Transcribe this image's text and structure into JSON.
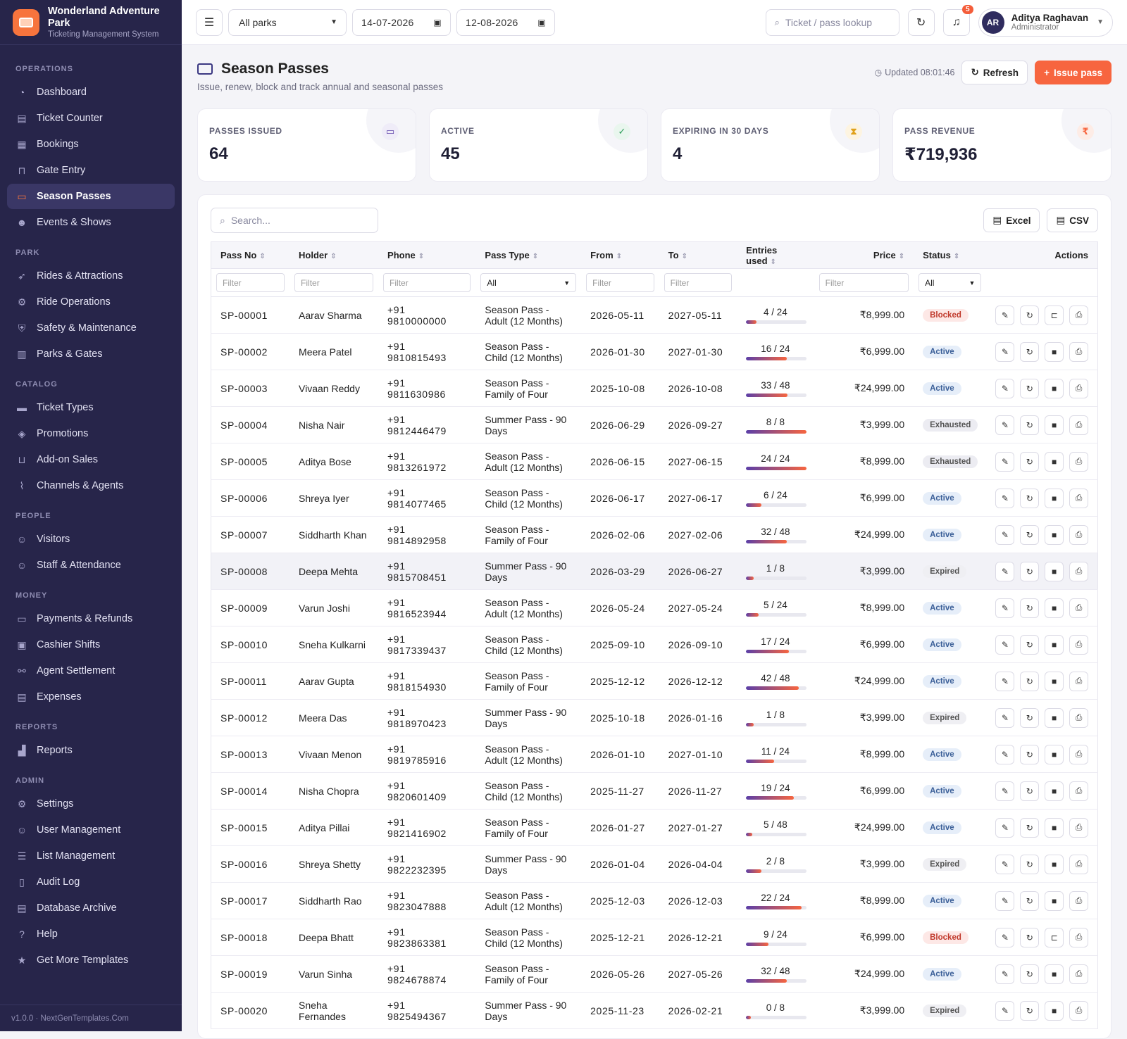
{
  "brand": {
    "name": "Wonderland Adventure Park",
    "subtitle": "Ticketing Management System"
  },
  "nav": [
    {
      "section": "OPERATIONS",
      "items": [
        {
          "label": "Dashboard",
          "icon": "gauge-icon",
          "glyph": "◔"
        },
        {
          "label": "Ticket Counter",
          "icon": "counter-icon",
          "glyph": "▤"
        },
        {
          "label": "Bookings",
          "icon": "bookings-icon",
          "glyph": "▦"
        },
        {
          "label": "Gate Entry",
          "icon": "gate-icon",
          "glyph": "⊓"
        },
        {
          "label": "Season Passes",
          "icon": "id-card-icon",
          "glyph": "▭",
          "active": true
        },
        {
          "label": "Events & Shows",
          "icon": "masks-icon",
          "glyph": "☻"
        }
      ]
    },
    {
      "section": "PARK",
      "items": [
        {
          "label": "Rides & Attractions",
          "icon": "rocket-icon",
          "glyph": "➶"
        },
        {
          "label": "Ride Operations",
          "icon": "gears-icon",
          "glyph": "⚙"
        },
        {
          "label": "Safety & Maintenance",
          "icon": "shield-icon",
          "glyph": "⛨"
        },
        {
          "label": "Parks & Gates",
          "icon": "building-icon",
          "glyph": "▥"
        }
      ]
    },
    {
      "section": "CATALOG",
      "items": [
        {
          "label": "Ticket Types",
          "icon": "ticket-icon",
          "glyph": "▬"
        },
        {
          "label": "Promotions",
          "icon": "tags-icon",
          "glyph": "◈"
        },
        {
          "label": "Add-on Sales",
          "icon": "basket-icon",
          "glyph": "⊔"
        },
        {
          "label": "Channels & Agents",
          "icon": "broadcast-icon",
          "glyph": "⌇"
        }
      ]
    },
    {
      "section": "PEOPLE",
      "items": [
        {
          "label": "Visitors",
          "icon": "users-icon",
          "glyph": "☺"
        },
        {
          "label": "Staff & Attendance",
          "icon": "user-group-icon",
          "glyph": "☺"
        }
      ]
    },
    {
      "section": "MONEY",
      "items": [
        {
          "label": "Payments & Refunds",
          "icon": "credit-card-icon",
          "glyph": "▭"
        },
        {
          "label": "Cashier Shifts",
          "icon": "cash-register-icon",
          "glyph": "▣"
        },
        {
          "label": "Agent Settlement",
          "icon": "handshake-icon",
          "glyph": "⚯"
        },
        {
          "label": "Expenses",
          "icon": "wallet-icon",
          "glyph": "▤"
        }
      ]
    },
    {
      "section": "REPORTS",
      "items": [
        {
          "label": "Reports",
          "icon": "chart-icon",
          "glyph": "▟"
        }
      ]
    },
    {
      "section": "ADMIN",
      "items": [
        {
          "label": "Settings",
          "icon": "gear-icon",
          "glyph": "⚙"
        },
        {
          "label": "User Management",
          "icon": "user-gear-icon",
          "glyph": "☺"
        },
        {
          "label": "List Management",
          "icon": "list-icon",
          "glyph": "☰"
        },
        {
          "label": "Audit Log",
          "icon": "clipboard-icon",
          "glyph": "▯"
        },
        {
          "label": "Database Archive",
          "icon": "archive-icon",
          "glyph": "▤"
        },
        {
          "label": "Help",
          "icon": "help-icon",
          "glyph": "?"
        },
        {
          "label": "Get More Templates",
          "icon": "star-icon",
          "glyph": "★"
        }
      ]
    }
  ],
  "footer": "v1.0.0 · NextGenTemplates.Com",
  "topbar": {
    "park_select": "All parks",
    "date_from": "14-07-2026",
    "date_to": "12-08-2026",
    "lookup_placeholder": "Ticket / pass lookup",
    "notifications": "5",
    "user": {
      "initials": "AR",
      "name": "Aditya Raghavan",
      "role": "Administrator"
    }
  },
  "page": {
    "title": "Season Passes",
    "subtitle": "Issue, renew, block and track annual and seasonal passes",
    "updated": "Updated 08:01:46",
    "refresh": "Refresh",
    "issue": "Issue pass"
  },
  "kpis": [
    {
      "label": "PASSES ISSUED",
      "value": "64",
      "icon": "id-card-icon",
      "glyph": "▭",
      "color": "#5b3fa8",
      "bg": "#efecf8"
    },
    {
      "label": "ACTIVE",
      "value": "45",
      "icon": "check-circle-icon",
      "glyph": "✓",
      "color": "#2e9e5b",
      "bg": "#e9f6ee"
    },
    {
      "label": "EXPIRING IN 30 DAYS",
      "value": "4",
      "icon": "hourglass-icon",
      "glyph": "⧗",
      "color": "#e0a11b",
      "bg": "#fdf4e1"
    },
    {
      "label": "PASS REVENUE",
      "value": "₹719,936",
      "icon": "rupee-icon",
      "glyph": "₹",
      "color": "#f7653f",
      "bg": "#fdece6"
    }
  ],
  "table": {
    "search_placeholder": "Search...",
    "excel": "Excel",
    "csv": "CSV",
    "columns": [
      "Pass No",
      "Holder",
      "Phone",
      "Pass Type",
      "From",
      "To",
      "Entries used",
      "Price",
      "Status",
      "Actions"
    ],
    "filter_placeholder": "Filter",
    "filter_all": "All",
    "rows": [
      {
        "no": "SP-00001",
        "holder": "Aarav Sharma",
        "phone": "+91 9810000000",
        "type": "Season Pass - Adult (12 Months)",
        "from": "2026-05-11",
        "to": "2027-05-11",
        "used": 4,
        "total": 24,
        "price": "₹8,999.00",
        "status": "Blocked"
      },
      {
        "no": "SP-00002",
        "holder": "Meera Patel",
        "phone": "+91 9810815493",
        "type": "Season Pass - Child (12 Months)",
        "from": "2026-01-30",
        "to": "2027-01-30",
        "used": 16,
        "total": 24,
        "price": "₹6,999.00",
        "status": "Active"
      },
      {
        "no": "SP-00003",
        "holder": "Vivaan Reddy",
        "phone": "+91 9811630986",
        "type": "Season Pass - Family of Four",
        "from": "2025-10-08",
        "to": "2026-10-08",
        "used": 33,
        "total": 48,
        "price": "₹24,999.00",
        "status": "Active"
      },
      {
        "no": "SP-00004",
        "holder": "Nisha Nair",
        "phone": "+91 9812446479",
        "type": "Summer Pass - 90 Days",
        "from": "2026-06-29",
        "to": "2026-09-27",
        "used": 8,
        "total": 8,
        "price": "₹3,999.00",
        "status": "Exhausted"
      },
      {
        "no": "SP-00005",
        "holder": "Aditya Bose",
        "phone": "+91 9813261972",
        "type": "Season Pass - Adult (12 Months)",
        "from": "2026-06-15",
        "to": "2027-06-15",
        "used": 24,
        "total": 24,
        "price": "₹8,999.00",
        "status": "Exhausted"
      },
      {
        "no": "SP-00006",
        "holder": "Shreya Iyer",
        "phone": "+91 9814077465",
        "type": "Season Pass - Child (12 Months)",
        "from": "2026-06-17",
        "to": "2027-06-17",
        "used": 6,
        "total": 24,
        "price": "₹6,999.00",
        "status": "Active"
      },
      {
        "no": "SP-00007",
        "holder": "Siddharth Khan",
        "phone": "+91 9814892958",
        "type": "Season Pass - Family of Four",
        "from": "2026-02-06",
        "to": "2027-02-06",
        "used": 32,
        "total": 48,
        "price": "₹24,999.00",
        "status": "Active"
      },
      {
        "no": "SP-00008",
        "holder": "Deepa Mehta",
        "phone": "+91 9815708451",
        "type": "Summer Pass - 90 Days",
        "from": "2026-03-29",
        "to": "2026-06-27",
        "used": 1,
        "total": 8,
        "price": "₹3,999.00",
        "status": "Expired"
      },
      {
        "no": "SP-00009",
        "holder": "Varun Joshi",
        "phone": "+91 9816523944",
        "type": "Season Pass - Adult (12 Months)",
        "from": "2026-05-24",
        "to": "2027-05-24",
        "used": 5,
        "total": 24,
        "price": "₹8,999.00",
        "status": "Active"
      },
      {
        "no": "SP-00010",
        "holder": "Sneha Kulkarni",
        "phone": "+91 9817339437",
        "type": "Season Pass - Child (12 Months)",
        "from": "2025-09-10",
        "to": "2026-09-10",
        "used": 17,
        "total": 24,
        "price": "₹6,999.00",
        "status": "Active"
      },
      {
        "no": "SP-00011",
        "holder": "Aarav Gupta",
        "phone": "+91 9818154930",
        "type": "Season Pass - Family of Four",
        "from": "2025-12-12",
        "to": "2026-12-12",
        "used": 42,
        "total": 48,
        "price": "₹24,999.00",
        "status": "Active"
      },
      {
        "no": "SP-00012",
        "holder": "Meera Das",
        "phone": "+91 9818970423",
        "type": "Summer Pass - 90 Days",
        "from": "2025-10-18",
        "to": "2026-01-16",
        "used": 1,
        "total": 8,
        "price": "₹3,999.00",
        "status": "Expired"
      },
      {
        "no": "SP-00013",
        "holder": "Vivaan Menon",
        "phone": "+91 9819785916",
        "type": "Season Pass - Adult (12 Months)",
        "from": "2026-01-10",
        "to": "2027-01-10",
        "used": 11,
        "total": 24,
        "price": "₹8,999.00",
        "status": "Active"
      },
      {
        "no": "SP-00014",
        "holder": "Nisha Chopra",
        "phone": "+91 9820601409",
        "type": "Season Pass - Child (12 Months)",
        "from": "2025-11-27",
        "to": "2026-11-27",
        "used": 19,
        "total": 24,
        "price": "₹6,999.00",
        "status": "Active"
      },
      {
        "no": "SP-00015",
        "holder": "Aditya Pillai",
        "phone": "+91 9821416902",
        "type": "Season Pass - Family of Four",
        "from": "2026-01-27",
        "to": "2027-01-27",
        "used": 5,
        "total": 48,
        "price": "₹24,999.00",
        "status": "Active"
      },
      {
        "no": "SP-00016",
        "holder": "Shreya Shetty",
        "phone": "+91 9822232395",
        "type": "Summer Pass - 90 Days",
        "from": "2026-01-04",
        "to": "2026-04-04",
        "used": 2,
        "total": 8,
        "price": "₹3,999.00",
        "status": "Expired"
      },
      {
        "no": "SP-00017",
        "holder": "Siddharth Rao",
        "phone": "+91 9823047888",
        "type": "Season Pass - Adult (12 Months)",
        "from": "2025-12-03",
        "to": "2026-12-03",
        "used": 22,
        "total": 24,
        "price": "₹8,999.00",
        "status": "Active"
      },
      {
        "no": "SP-00018",
        "holder": "Deepa Bhatt",
        "phone": "+91 9823863381",
        "type": "Season Pass - Child (12 Months)",
        "from": "2025-12-21",
        "to": "2026-12-21",
        "used": 9,
        "total": 24,
        "price": "₹6,999.00",
        "status": "Blocked"
      },
      {
        "no": "SP-00019",
        "holder": "Varun Sinha",
        "phone": "+91 9824678874",
        "type": "Season Pass - Family of Four",
        "from": "2026-05-26",
        "to": "2027-05-26",
        "used": 32,
        "total": 48,
        "price": "₹24,999.00",
        "status": "Active"
      },
      {
        "no": "SP-00020",
        "holder": "Sneha Fernandes",
        "phone": "+91 9825494367",
        "type": "Summer Pass - 90 Days",
        "from": "2025-11-23",
        "to": "2026-02-21",
        "used": 0,
        "total": 8,
        "price": "₹3,999.00",
        "status": "Expired"
      }
    ]
  }
}
